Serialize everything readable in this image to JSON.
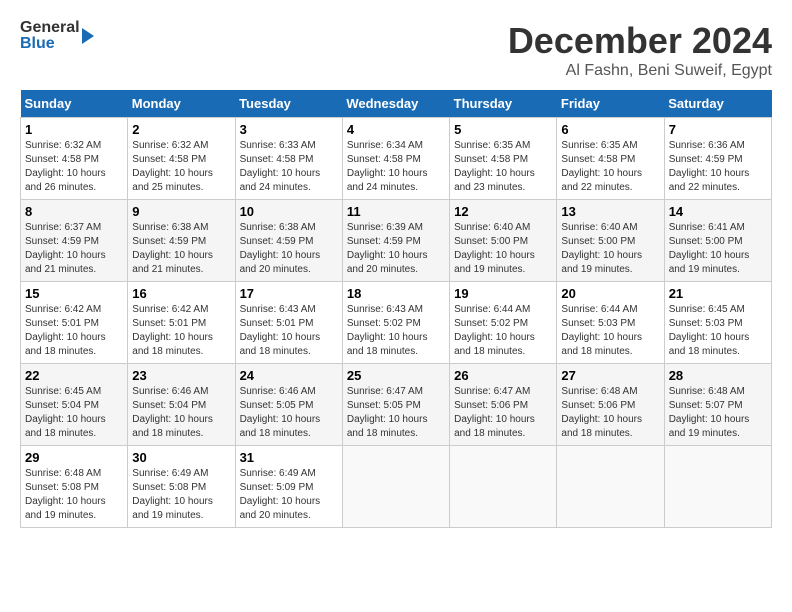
{
  "header": {
    "logo_general": "General",
    "logo_blue": "Blue",
    "month_title": "December 2024",
    "location": "Al Fashn, Beni Suweif, Egypt"
  },
  "days_of_week": [
    "Sunday",
    "Monday",
    "Tuesday",
    "Wednesday",
    "Thursday",
    "Friday",
    "Saturday"
  ],
  "weeks": [
    [
      {
        "day": "1",
        "sunrise": "6:32 AM",
        "sunset": "4:58 PM",
        "daylight": "10 hours and 26 minutes."
      },
      {
        "day": "2",
        "sunrise": "6:32 AM",
        "sunset": "4:58 PM",
        "daylight": "10 hours and 25 minutes."
      },
      {
        "day": "3",
        "sunrise": "6:33 AM",
        "sunset": "4:58 PM",
        "daylight": "10 hours and 24 minutes."
      },
      {
        "day": "4",
        "sunrise": "6:34 AM",
        "sunset": "4:58 PM",
        "daylight": "10 hours and 24 minutes."
      },
      {
        "day": "5",
        "sunrise": "6:35 AM",
        "sunset": "4:58 PM",
        "daylight": "10 hours and 23 minutes."
      },
      {
        "day": "6",
        "sunrise": "6:35 AM",
        "sunset": "4:58 PM",
        "daylight": "10 hours and 22 minutes."
      },
      {
        "day": "7",
        "sunrise": "6:36 AM",
        "sunset": "4:59 PM",
        "daylight": "10 hours and 22 minutes."
      }
    ],
    [
      {
        "day": "8",
        "sunrise": "6:37 AM",
        "sunset": "4:59 PM",
        "daylight": "10 hours and 21 minutes."
      },
      {
        "day": "9",
        "sunrise": "6:38 AM",
        "sunset": "4:59 PM",
        "daylight": "10 hours and 21 minutes."
      },
      {
        "day": "10",
        "sunrise": "6:38 AM",
        "sunset": "4:59 PM",
        "daylight": "10 hours and 20 minutes."
      },
      {
        "day": "11",
        "sunrise": "6:39 AM",
        "sunset": "4:59 PM",
        "daylight": "10 hours and 20 minutes."
      },
      {
        "day": "12",
        "sunrise": "6:40 AM",
        "sunset": "5:00 PM",
        "daylight": "10 hours and 19 minutes."
      },
      {
        "day": "13",
        "sunrise": "6:40 AM",
        "sunset": "5:00 PM",
        "daylight": "10 hours and 19 minutes."
      },
      {
        "day": "14",
        "sunrise": "6:41 AM",
        "sunset": "5:00 PM",
        "daylight": "10 hours and 19 minutes."
      }
    ],
    [
      {
        "day": "15",
        "sunrise": "6:42 AM",
        "sunset": "5:01 PM",
        "daylight": "10 hours and 18 minutes."
      },
      {
        "day": "16",
        "sunrise": "6:42 AM",
        "sunset": "5:01 PM",
        "daylight": "10 hours and 18 minutes."
      },
      {
        "day": "17",
        "sunrise": "6:43 AM",
        "sunset": "5:01 PM",
        "daylight": "10 hours and 18 minutes."
      },
      {
        "day": "18",
        "sunrise": "6:43 AM",
        "sunset": "5:02 PM",
        "daylight": "10 hours and 18 minutes."
      },
      {
        "day": "19",
        "sunrise": "6:44 AM",
        "sunset": "5:02 PM",
        "daylight": "10 hours and 18 minutes."
      },
      {
        "day": "20",
        "sunrise": "6:44 AM",
        "sunset": "5:03 PM",
        "daylight": "10 hours and 18 minutes."
      },
      {
        "day": "21",
        "sunrise": "6:45 AM",
        "sunset": "5:03 PM",
        "daylight": "10 hours and 18 minutes."
      }
    ],
    [
      {
        "day": "22",
        "sunrise": "6:45 AM",
        "sunset": "5:04 PM",
        "daylight": "10 hours and 18 minutes."
      },
      {
        "day": "23",
        "sunrise": "6:46 AM",
        "sunset": "5:04 PM",
        "daylight": "10 hours and 18 minutes."
      },
      {
        "day": "24",
        "sunrise": "6:46 AM",
        "sunset": "5:05 PM",
        "daylight": "10 hours and 18 minutes."
      },
      {
        "day": "25",
        "sunrise": "6:47 AM",
        "sunset": "5:05 PM",
        "daylight": "10 hours and 18 minutes."
      },
      {
        "day": "26",
        "sunrise": "6:47 AM",
        "sunset": "5:06 PM",
        "daylight": "10 hours and 18 minutes."
      },
      {
        "day": "27",
        "sunrise": "6:48 AM",
        "sunset": "5:06 PM",
        "daylight": "10 hours and 18 minutes."
      },
      {
        "day": "28",
        "sunrise": "6:48 AM",
        "sunset": "5:07 PM",
        "daylight": "10 hours and 19 minutes."
      }
    ],
    [
      {
        "day": "29",
        "sunrise": "6:48 AM",
        "sunset": "5:08 PM",
        "daylight": "10 hours and 19 minutes."
      },
      {
        "day": "30",
        "sunrise": "6:49 AM",
        "sunset": "5:08 PM",
        "daylight": "10 hours and 19 minutes."
      },
      {
        "day": "31",
        "sunrise": "6:49 AM",
        "sunset": "5:09 PM",
        "daylight": "10 hours and 20 minutes."
      },
      null,
      null,
      null,
      null
    ]
  ]
}
